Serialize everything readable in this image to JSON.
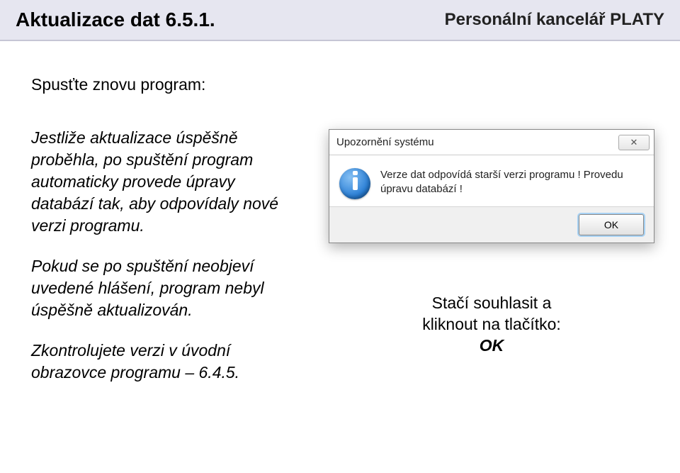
{
  "header": {
    "left": "Aktualizace dat 6.5.1.",
    "right": "Personální kancelář PLATY"
  },
  "left": {
    "intro": "Spusťte znovu program:",
    "para1": "Jestliže aktualizace úspěšně proběhla, po spuštění program automaticky provede úpravy databází tak, aby odpovídaly nové verzi programu.",
    "para2": "Pokud se po spuštění neobjeví uvedené hlášení, program nebyl úspěšně aktualizován.",
    "para3": "Zkontrolujete verzi v úvodní obrazovce programu – 6.4.5."
  },
  "dialog": {
    "title": "Upozornění systému",
    "close": "✕",
    "message": "Verze dat odpovídá starší verzi programu ! Provedu úpravu databází !",
    "ok": "OK"
  },
  "caption": {
    "line1": "Stačí  souhlasit a",
    "line2": "kliknout na tlačítko:",
    "ok": "OK"
  }
}
